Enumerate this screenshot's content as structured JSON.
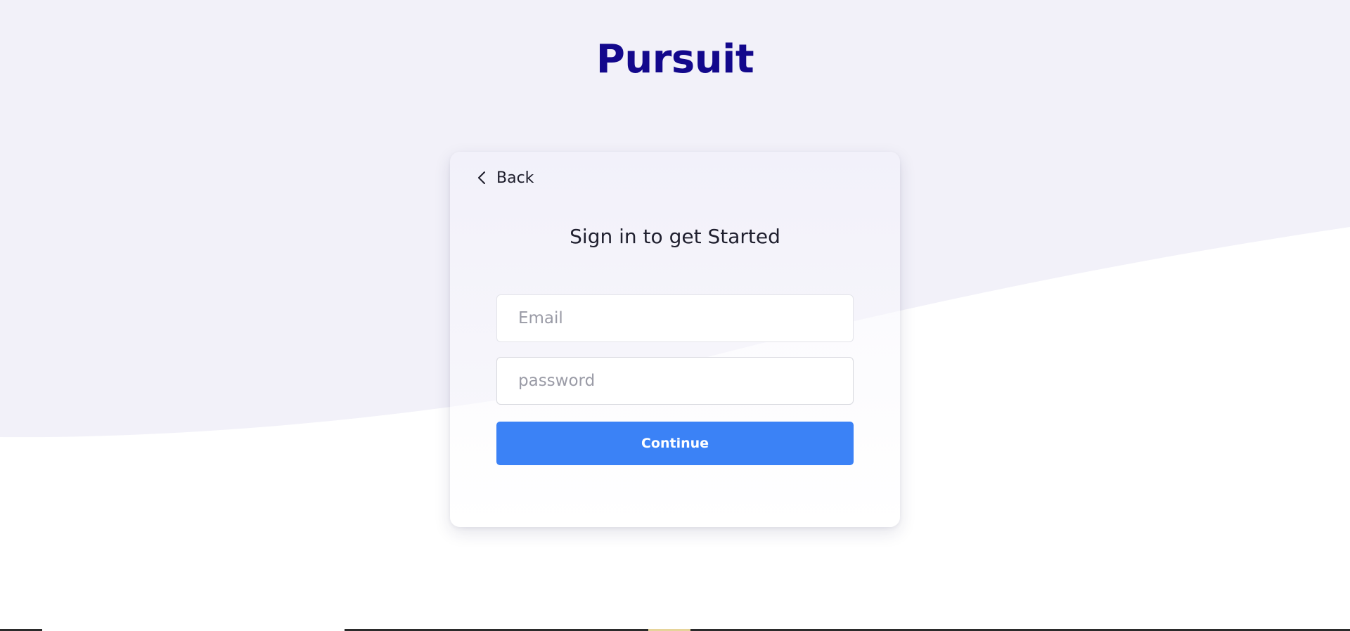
{
  "brand": {
    "name": "Pursuit",
    "color": "#13088c"
  },
  "theme": {
    "background_tint": "#f2f1f9",
    "primary_button": "#3b82f6"
  },
  "card": {
    "back_label": "Back",
    "back_icon": "chevron-left-icon",
    "heading": "Sign in to get Started",
    "email_placeholder": "Email",
    "password_placeholder": "password",
    "continue_label": "Continue"
  }
}
